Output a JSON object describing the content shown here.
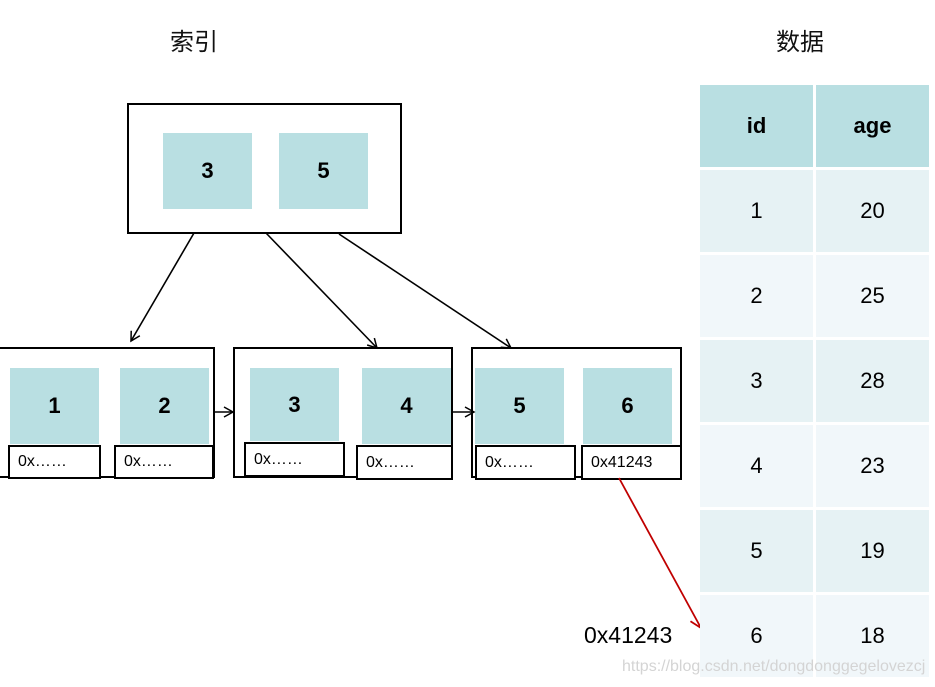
{
  "titles": {
    "index": "索引",
    "data": "数据"
  },
  "root_node": {
    "keys": [
      "3",
      "5"
    ]
  },
  "leaf_nodes": [
    {
      "keys": [
        "1",
        "2"
      ],
      "pointers": [
        "0x……",
        "0x……"
      ]
    },
    {
      "keys": [
        "3",
        "4"
      ],
      "pointers": [
        "0x……",
        "0x……"
      ]
    },
    {
      "keys": [
        "5",
        "6"
      ],
      "pointers": [
        "0x……",
        "0x41243"
      ]
    }
  ],
  "table": {
    "headers": [
      "id",
      "age"
    ],
    "rows": [
      [
        "1",
        "20"
      ],
      [
        "2",
        "25"
      ],
      [
        "3",
        "28"
      ],
      [
        "4",
        "23"
      ],
      [
        "5",
        "19"
      ],
      [
        "6",
        "18"
      ]
    ]
  },
  "address_label": "0x41243",
  "watermark": "https://blog.csdn.net/dongdonggegelovezcj",
  "colors": {
    "key_fill": "#b9dfe2",
    "pointer_arrow": "#c00000"
  }
}
